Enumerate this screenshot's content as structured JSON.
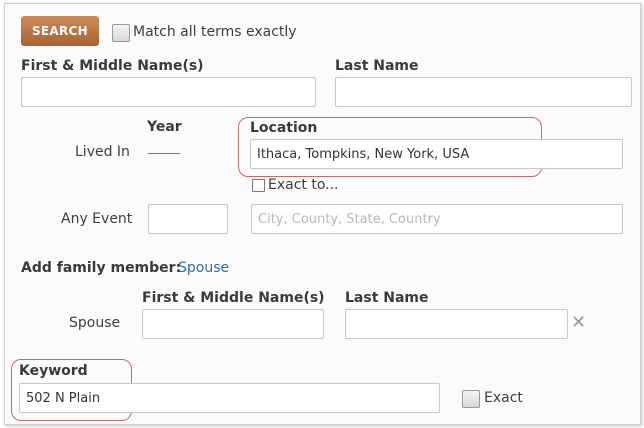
{
  "toolbar": {
    "search_label": "SEARCH",
    "match_exact_label": "Match all terms exactly"
  },
  "name": {
    "first_label": "First & Middle Name(s)",
    "first_value": "",
    "last_label": "Last Name",
    "last_value": ""
  },
  "lived_in": {
    "row_label": "Lived In",
    "year_label": "Year",
    "year_value": "—",
    "location_label": "Location",
    "location_value": "Ithaca, Tompkins, New York, USA",
    "exact_label": "Exact to..."
  },
  "any_event": {
    "row_label": "Any Event",
    "year_value": "",
    "location_placeholder": "City, County, State, Country"
  },
  "family": {
    "heading": "Add family member:",
    "spouse_link": "Spouse",
    "row_label": "Spouse",
    "first_label": "First & Middle Name(s)",
    "first_value": "",
    "last_label": "Last Name",
    "last_value": ""
  },
  "keyword": {
    "label": "Keyword",
    "value": "502 N Plain",
    "exact_label": "Exact"
  },
  "colors": {
    "search_button": "#b0703f",
    "highlight": "#c56a6a",
    "link": "#2f6f9f"
  }
}
